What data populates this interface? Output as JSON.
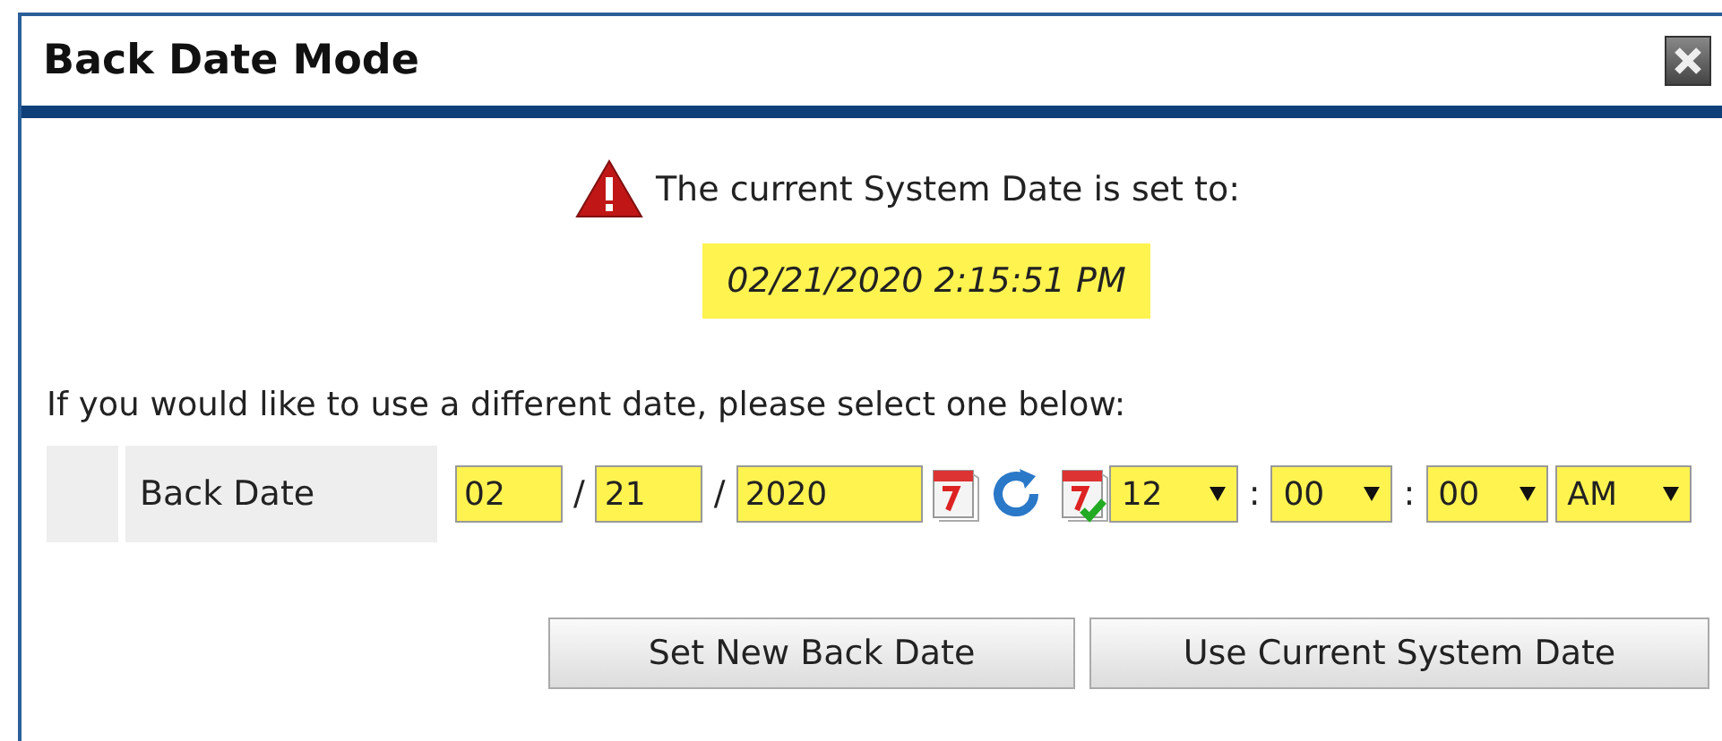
{
  "window": {
    "title": "Back Date Mode"
  },
  "notice": {
    "message": "The current System Date is set to:",
    "system_date": "02/21/2020 2:15:51 PM"
  },
  "instruction": "If you would like to use a different date, please select one below:",
  "back_date": {
    "label": "Back Date",
    "month": "02",
    "date_separator_1": "/",
    "day": "21",
    "date_separator_2": "/",
    "year": "2020",
    "hour": "12",
    "time_separator_1": ":",
    "minute": "00",
    "time_separator_2": ":",
    "second": "00",
    "meridiem": "AM"
  },
  "buttons": [
    "Set New Back Date",
    "Use Current System Date"
  ]
}
